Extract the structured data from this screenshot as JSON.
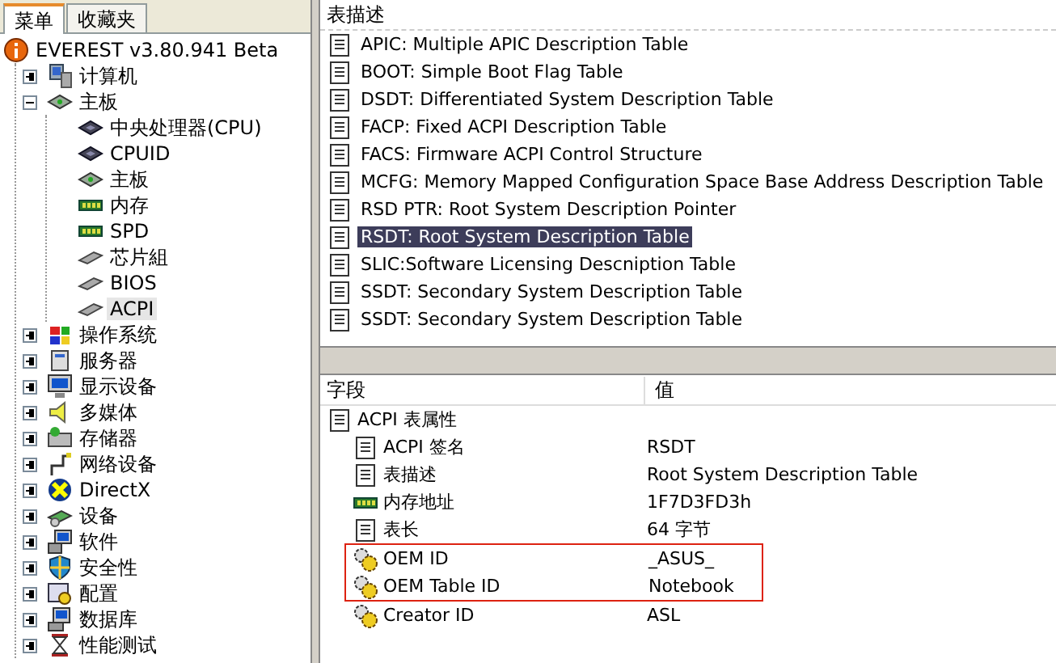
{
  "tabs": [
    {
      "label": "菜单",
      "selected": true
    },
    {
      "label": "收藏夹",
      "selected": false
    }
  ],
  "tree": [
    {
      "label": "EVEREST v3.80.941 Beta",
      "selected": false,
      "children": [
        {
          "label": "计算机",
          "selected": false,
          "expanded": false
        },
        {
          "label": "主板",
          "selected": false,
          "expanded": true,
          "children": [
            {
              "label": "中央处理器(CPU)",
              "selected": false
            },
            {
              "label": "CPUID",
              "selected": false
            },
            {
              "label": "主板",
              "selected": false
            },
            {
              "label": "内存",
              "selected": false
            },
            {
              "label": "SPD",
              "selected": false
            },
            {
              "label": "芯片組",
              "selected": false
            },
            {
              "label": "BIOS",
              "selected": false
            },
            {
              "label": "ACPI",
              "selected": true
            }
          ]
        },
        {
          "label": "操作系统",
          "selected": false,
          "expanded": false
        },
        {
          "label": "服务器",
          "selected": false,
          "expanded": false
        },
        {
          "label": "显示设备",
          "selected": false,
          "expanded": false
        },
        {
          "label": "多媒体",
          "selected": false,
          "expanded": false
        },
        {
          "label": "存储器",
          "selected": false,
          "expanded": false
        },
        {
          "label": "网络设备",
          "selected": false,
          "expanded": false
        },
        {
          "label": "DirectX",
          "selected": false,
          "expanded": false
        },
        {
          "label": "设备",
          "selected": false,
          "expanded": false
        },
        {
          "label": "软件",
          "selected": false,
          "expanded": false
        },
        {
          "label": "安全性",
          "selected": false,
          "expanded": false
        },
        {
          "label": "配置",
          "selected": false,
          "expanded": false
        },
        {
          "label": "数据库",
          "selected": false,
          "expanded": false
        },
        {
          "label": "性能测试",
          "selected": false,
          "expanded": false
        }
      ]
    }
  ],
  "tables": {
    "header": "表描述",
    "rows": [
      {
        "label": "APIC: Multiple APIC Description Table",
        "selected": false
      },
      {
        "label": "BOOT: Simple Boot Flag Table",
        "selected": false
      },
      {
        "label": "DSDT: Differentiated System Description Table",
        "selected": false
      },
      {
        "label": "FACP: Fixed ACPI Description Table",
        "selected": false
      },
      {
        "label": "FACS: Firmware ACPI Control Structure",
        "selected": false
      },
      {
        "label": "MCFG: Memory Mapped Configuration Space Base Address Description Table",
        "selected": false
      },
      {
        "label": "RSD PTR: Root System Description Pointer",
        "selected": false
      },
      {
        "label": "RSDT: Root System Description Table",
        "selected": true
      },
      {
        "label": "SLIC:Software Licensing Descniption Table",
        "selected": false
      },
      {
        "label": "SSDT: Secondary System Description Table",
        "selected": false
      },
      {
        "label": "SSDT: Secondary System Description Table",
        "selected": false
      }
    ]
  },
  "details": {
    "columns": [
      "字段",
      "值"
    ],
    "groups": [
      {
        "field": "ACPI 表属性",
        "children": [
          {
            "field": "ACPI 签名",
            "value": "RSDT",
            "outlined": false
          },
          {
            "field": "表描述",
            "value": "Root System Description Table",
            "outlined": false
          },
          {
            "field": "内存地址",
            "value": "1F7D3FD3h",
            "outlined": false
          },
          {
            "field": "表长",
            "value": "64 字节",
            "outlined": false
          },
          {
            "field": "OEM ID",
            "value": "_ASUS_",
            "outlined": true
          },
          {
            "field": "OEM Table ID",
            "value": "Notebook",
            "outlined": true
          },
          {
            "field": "Creator ID",
            "value": "ASL",
            "outlined": false
          }
        ]
      }
    ]
  }
}
